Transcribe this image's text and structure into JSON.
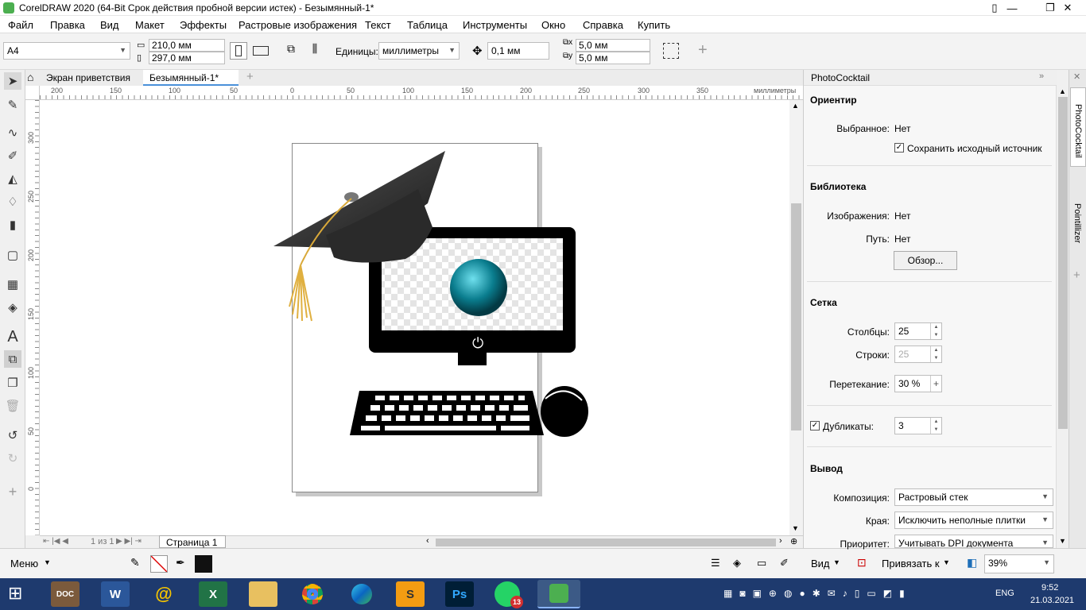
{
  "title_bar": {
    "title": "CorelDRAW 2020 (64-Bit Срок действия пробной версии истек) - Безымянный-1*"
  },
  "menu": [
    "Файл",
    "Правка",
    "Вид",
    "Макет",
    "Эффекты",
    "Растровые изображения",
    "Текст",
    "Таблица",
    "Инструменты",
    "Окно",
    "Справка",
    "Купить"
  ],
  "property_bar": {
    "page_size": "A4",
    "width": "210,0 мм",
    "height": "297,0 мм",
    "units_label": "Единицы:",
    "units": "миллиметры",
    "nudge": "0,1 мм",
    "dup_x": "5,0 мм",
    "dup_y": "5,0 мм",
    "plus": "+"
  },
  "tabs": {
    "welcome": "Экран приветствия",
    "doc": "Безымянный-1*",
    "add": "+"
  },
  "ruler_h": {
    "labels": [
      "200",
      "150",
      "100",
      "50",
      "0",
      "50",
      "100",
      "150",
      "200",
      "250",
      "300",
      "350"
    ],
    "units": "миллиметры"
  },
  "ruler_v": {
    "labels": [
      "300",
      "250",
      "200",
      "150",
      "100",
      "50",
      "0"
    ]
  },
  "page_nav": {
    "of": "1   из   1",
    "page_tab": "Страница 1"
  },
  "bottom": {
    "menu": "Меню",
    "view": "Вид",
    "snap": "Привязать к",
    "zoom": "39%"
  },
  "docker": {
    "title": "PhotoCocktail",
    "orient": {
      "heading": "Ориентир",
      "selected_label": "Выбранное:",
      "selected_value": "Нет",
      "keep_source": "Сохранить исходный источник"
    },
    "library": {
      "heading": "Библиотека",
      "images_label": "Изображения:",
      "images_value": "Нет",
      "path_label": "Путь:",
      "path_value": "Нет",
      "browse": "Обзор..."
    },
    "grid": {
      "heading": "Сетка",
      "cols_label": "Столбцы:",
      "cols": "25",
      "rows_label": "Строки:",
      "rows": "25",
      "overlap_label": "Перетекание:",
      "overlap": "30 %",
      "dups_label": "Дубликаты:",
      "dups": "3"
    },
    "output": {
      "heading": "Вывод",
      "comp_label": "Композиция:",
      "comp": "Растровый стек",
      "edges_label": "Края:",
      "edges": "Исключить неполные плитки",
      "priority_label": "Приоритет:",
      "priority": "Учитывать DPI документа"
    }
  },
  "side_tabs": [
    "PhotoCocktail",
    "Pointillizer"
  ],
  "taskbar": {
    "apps": [
      "DOC",
      "W",
      "@",
      "X",
      "",
      "",
      "",
      "S",
      "Ps",
      "13",
      ""
    ],
    "lang": "ENG",
    "time": "9:52",
    "date": "21.03.2021"
  }
}
